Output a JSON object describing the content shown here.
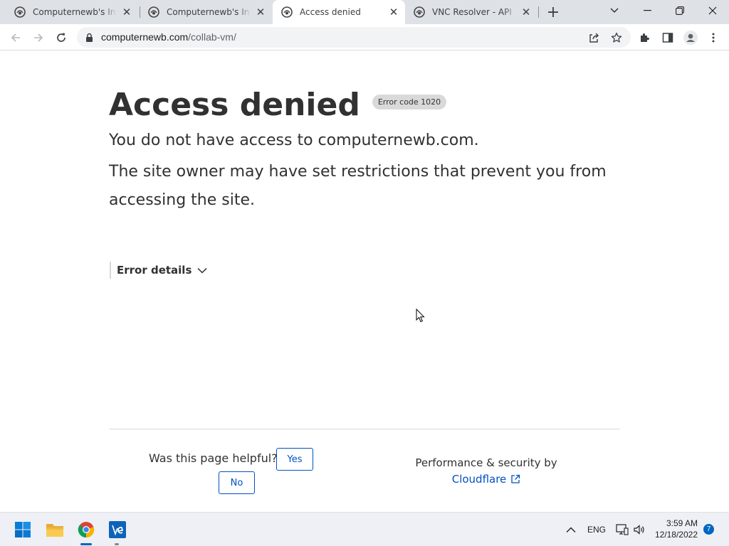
{
  "browser": {
    "tabs": [
      {
        "title": "Computernewb's Internet",
        "active": false
      },
      {
        "title": "Computernewb's Internet",
        "active": false
      },
      {
        "title": "Access denied",
        "active": true
      },
      {
        "title": "VNC Resolver - API",
        "active": false
      }
    ],
    "url_host": "computernewb.com",
    "url_path": "/collab-vm/"
  },
  "page": {
    "title": "Access denied",
    "error_badge": "Error code 1020",
    "line1": "You do not have access to computernewb.com.",
    "line2": "The site owner may have set restrictions that prevent you from accessing the site.",
    "details_label": "Error details",
    "helpful_question": "Was this page helpful?",
    "yes_label": "Yes",
    "no_label": "No",
    "perf_text": "Performance & security by",
    "cloudflare_label": "Cloudflare"
  },
  "taskbar": {
    "language": "ENG",
    "time": "3:59 AM",
    "date": "12/18/2022",
    "notification_count": "7"
  },
  "colors": {
    "link": "#0051c3",
    "text": "#313131",
    "tabstrip": "#dee1e6"
  }
}
